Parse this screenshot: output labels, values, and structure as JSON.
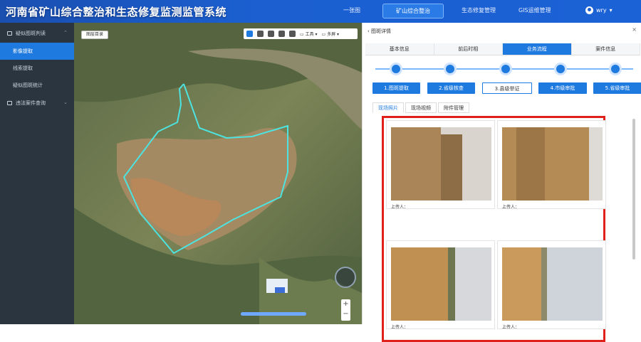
{
  "header": {
    "title": "河南省矿山综合整治和生态修复监测监管系统",
    "nav": [
      "一张图",
      "矿山综合整治",
      "生态修复管理",
      "GIS运维管理"
    ],
    "user": "wry"
  },
  "sidebar": {
    "groups": [
      {
        "label": "疑似图斑判读",
        "items": [
          "影像提取",
          "线索提取",
          "疑似图斑统计"
        ]
      },
      {
        "label": "违法案件查询",
        "items": []
      }
    ]
  },
  "map": {
    "layer_button": "图层目录",
    "toolbar": {
      "tools_label": "工具",
      "multiscreen_label": "多屏"
    },
    "zoom_in": "+",
    "zoom_out": "−"
  },
  "panel": {
    "title": "图斑详情",
    "close": "×",
    "tabs": [
      "基本信息",
      "前后时相",
      "业务流程",
      "案件信息"
    ],
    "active_tab": "业务流程",
    "steps": [
      "1.图斑提取",
      "2.省级核查",
      "3.县级举证",
      "4.市级审批",
      "5.省级审批"
    ],
    "active_step": "3.县级举证",
    "sub_tabs": [
      "现场照片",
      "现场视频",
      "附件管理"
    ],
    "active_sub_tab": "现场照片",
    "photos": [
      {
        "uploader_label": "上传人："
      },
      {
        "uploader_label": "上传人："
      },
      {
        "uploader_label": "上传人："
      },
      {
        "uploader_label": "上传人："
      }
    ]
  }
}
